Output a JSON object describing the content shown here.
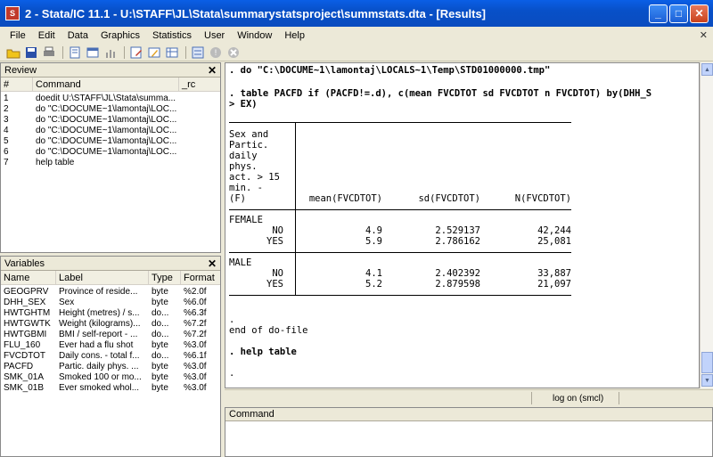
{
  "window": {
    "title": "2 - Stata/IC 11.1 - U:\\STAFF\\JL\\Stata\\summarystatsproject\\summstats.dta - [Results]",
    "minimize": "_",
    "maximize": "□",
    "close": "✕",
    "mdi_close": "✕"
  },
  "menu": [
    "File",
    "Edit",
    "Data",
    "Graphics",
    "Statistics",
    "User",
    "Window",
    "Help"
  ],
  "toolbar": {
    "icons": [
      "open-icon",
      "save-icon",
      "print-icon",
      "log-icon",
      "viewer-icon",
      "graph-icon",
      "do-file-editor-icon",
      "data-editor-icon",
      "data-browser-icon",
      "variables-manager-icon",
      "more-icon",
      "break-icon"
    ]
  },
  "review": {
    "title": "Review",
    "close": "✕",
    "columns": [
      "#",
      "Command",
      "_rc"
    ],
    "rows": [
      {
        "n": "1",
        "cmd": "doedit U:\\STAFF\\JL\\Stata\\summa..."
      },
      {
        "n": "2",
        "cmd": "do \"C:\\DOCUME~1\\lamontaj\\LOC..."
      },
      {
        "n": "3",
        "cmd": "do \"C:\\DOCUME~1\\lamontaj\\LOC..."
      },
      {
        "n": "4",
        "cmd": "do \"C:\\DOCUME~1\\lamontaj\\LOC..."
      },
      {
        "n": "5",
        "cmd": "do \"C:\\DOCUME~1\\lamontaj\\LOC..."
      },
      {
        "n": "6",
        "cmd": "do \"C:\\DOCUME~1\\lamontaj\\LOC..."
      },
      {
        "n": "7",
        "cmd": "help table"
      }
    ]
  },
  "variables": {
    "title": "Variables",
    "close": "✕",
    "columns": [
      "Name",
      "Label",
      "Type",
      "Format"
    ],
    "rows": [
      {
        "name": "GEOGPRV",
        "label": "Province of reside...",
        "type": "byte",
        "format": "%2.0f"
      },
      {
        "name": "DHH_SEX",
        "label": "Sex",
        "type": "byte",
        "format": "%6.0f"
      },
      {
        "name": "HWTGHTM",
        "label": "Height (metres) / s...",
        "type": "do...",
        "format": "%6.3f"
      },
      {
        "name": "HWTGWTK",
        "label": "Weight (kilograms)...",
        "type": "do...",
        "format": "%7.2f"
      },
      {
        "name": "HWTGBMI",
        "label": "BMI / self-report - ...",
        "type": "do...",
        "format": "%7.2f"
      },
      {
        "name": "FLU_160",
        "label": "Ever had a flu shot",
        "type": "byte",
        "format": "%3.0f"
      },
      {
        "name": "FVCDTOT",
        "label": "Daily cons. - total f...",
        "type": "do...",
        "format": "%6.1f"
      },
      {
        "name": "PACFD",
        "label": "Partic. daily phys. ...",
        "type": "byte",
        "format": "%3.0f"
      },
      {
        "name": "SMK_01A",
        "label": "Smoked 100 or mo...",
        "type": "byte",
        "format": "%3.0f"
      },
      {
        "name": "SMK_01B",
        "label": "Ever smoked whol...",
        "type": "byte",
        "format": "%3.0f"
      }
    ]
  },
  "results": {
    "lines": [
      {
        "text": ". do \"C:\\DOCUME~1\\lamontaj\\LOCALS~1\\Temp\\STD01000000.tmp\"",
        "bold": true
      },
      {
        "text": ". table PACFD if (PACFD!=.d), c(mean FVCDTOT sd FVCDTOT n FVCDTOT) by(DHH_S",
        "bold": true
      },
      {
        "text": "> EX)",
        "bold": true
      }
    ],
    "table": {
      "stub_header": [
        "Sex and",
        "Partic.",
        "daily",
        "phys.",
        "act. > 15",
        "min. -",
        "(F)"
      ],
      "col_headers": [
        "mean(FVCDTOT)",
        "sd(FVCDTOT)",
        "N(FVCDTOT)"
      ],
      "groups": [
        {
          "name": "FEMALE",
          "rows": [
            {
              "label": "NO",
              "mean": "4.9",
              "sd": "2.529137",
              "n": "42,244"
            },
            {
              "label": "YES",
              "mean": "5.9",
              "sd": "2.786162",
              "n": "25,081"
            }
          ]
        },
        {
          "name": "MALE",
          "rows": [
            {
              "label": "NO",
              "mean": "4.1",
              "sd": "2.402392",
              "n": "33,887"
            },
            {
              "label": "YES",
              "mean": "5.2",
              "sd": "2.879598",
              "n": "21,097"
            }
          ]
        }
      ]
    },
    "tail": [
      ".",
      "end of do-file",
      ". help table",
      "."
    ]
  },
  "status": {
    "log": "log on (smcl)"
  },
  "command": {
    "title": "Command",
    "value": ""
  }
}
